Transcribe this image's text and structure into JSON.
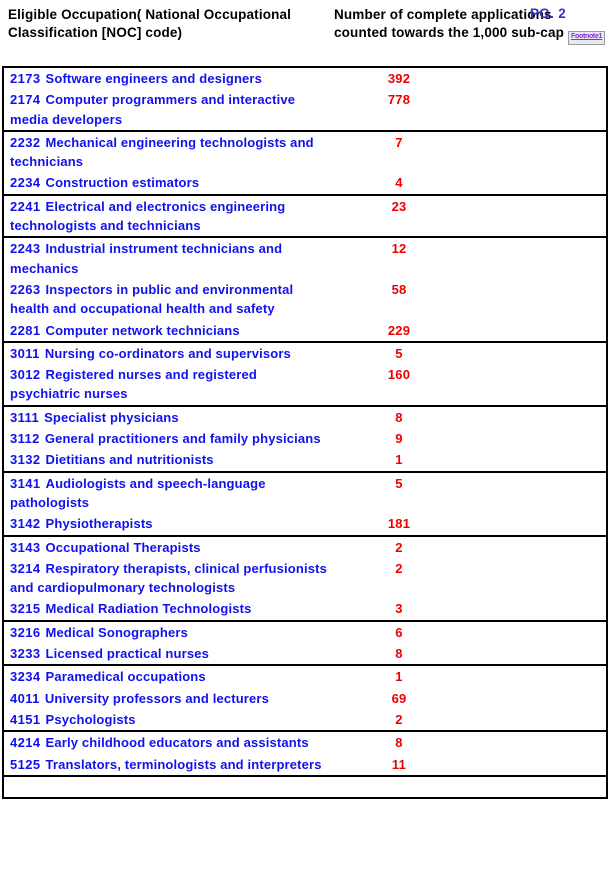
{
  "header": {
    "col_occupation": "Eligible Occupation( National Occupational Classification [NOC] code)",
    "col_applications": "Number of complete applications counted towards the 1,000 sub-cap",
    "page_label": "PG. 2",
    "footnote_link": "Footnote1"
  },
  "colors": {
    "occupation_text": "#1111ee",
    "number_text": "#ee0000",
    "header_text": "#000000",
    "page_label": "#3333cc",
    "footnote_link": "#8a2be2",
    "border": "#000000"
  },
  "table": {
    "groups": [
      {
        "rows": [
          {
            "code": "2173",
            "occupation": "Software engineers and designers",
            "applications": "392"
          },
          {
            "code": "2174",
            "occupation": "Computer programmers and interactive media developers",
            "applications": "778"
          }
        ]
      },
      {
        "rows": [
          {
            "code": "2232",
            "occupation": "Mechanical engineering technologists and technicians",
            "applications": "7"
          },
          {
            "code": "2234",
            "occupation": "Construction estimators",
            "applications": "4"
          }
        ]
      },
      {
        "rows": [
          {
            "code": "2241",
            "occupation": "Electrical and electronics engineering technologists and technicians",
            "applications": "23"
          }
        ]
      },
      {
        "rows": [
          {
            "code": "2243",
            "occupation": "Industrial instrument technicians and mechanics",
            "applications": "12"
          },
          {
            "code": "2263",
            "occupation": "Inspectors in public and environmental health and occupational health and safety",
            "applications": "58"
          },
          {
            "code": "2281",
            "occupation": "Computer network technicians",
            "applications": "229"
          }
        ]
      },
      {
        "rows": [
          {
            "code": "3011",
            "occupation": "Nursing co-ordinators and supervisors",
            "applications": "5"
          },
          {
            "code": "3012",
            "occupation": "Registered nurses and registered psychiatric nurses",
            "applications": "160"
          }
        ]
      },
      {
        "rows": [
          {
            "code": "3111",
            "occupation": "Specialist physicians",
            "applications": "8"
          },
          {
            "code": "3112",
            "occupation": "General practitioners and family physicians",
            "applications": "9"
          },
          {
            "code": "3132",
            "occupation": "Dietitians and nutritionists",
            "applications": "1"
          }
        ]
      },
      {
        "rows": [
          {
            "code": "3141",
            "occupation": "Audiologists and speech-language pathologists",
            "applications": "5"
          },
          {
            "code": "3142",
            "occupation": "Physiotherapists",
            "applications": "181"
          }
        ]
      },
      {
        "rows": [
          {
            "code": "3143",
            "occupation": "Occupational Therapists",
            "applications": "2"
          },
          {
            "code": "3214",
            "occupation": "Respiratory therapists, clinical perfusionists and cardiopulmonary technologists",
            "applications": "2"
          },
          {
            "code": "3215",
            "occupation": "Medical Radiation Technologists",
            "applications": "3"
          }
        ]
      },
      {
        "rows": [
          {
            "code": "3216",
            "occupation": "Medical Sonographers",
            "applications": "6"
          },
          {
            "code": "3233",
            "occupation": "Licensed practical nurses",
            "applications": "8"
          }
        ]
      },
      {
        "rows": [
          {
            "code": "3234",
            "occupation": "Paramedical occupations",
            "applications": "1"
          },
          {
            "code": "4011",
            "occupation": "University professors and lecturers",
            "applications": "69"
          },
          {
            "code": "4151",
            "occupation": "Psychologists",
            "applications": "2"
          }
        ]
      },
      {
        "rows": [
          {
            "code": "4214",
            "occupation": "Early childhood educators and assistants",
            "applications": "8"
          },
          {
            "code": "5125",
            "occupation": "Translators, terminologists and interpreters",
            "applications": "11"
          }
        ]
      }
    ]
  }
}
